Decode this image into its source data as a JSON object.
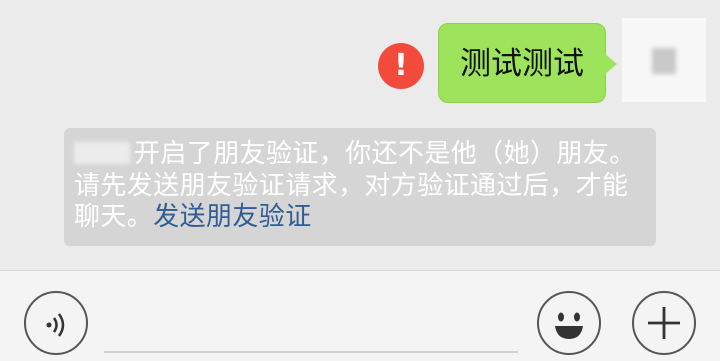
{
  "message": {
    "text": "测试测试",
    "status": "send-failed",
    "status_icon": "exclamation-icon",
    "status_glyph": "!"
  },
  "system_notice": {
    "text": "开启了朋友验证，你还不是他（她）朋友。请先发送朋友验证请求，对方验证通过后，才能聊天。",
    "link_text": "发送朋友验证"
  },
  "input_bar": {
    "left_icon": "voice-icon",
    "right_icons": [
      "emoji-icon",
      "plus-icon"
    ]
  },
  "colors": {
    "background": "#ebebeb",
    "bubble": "#9ee35c",
    "error": "#f24b3c",
    "notice_bg": "#d5d5d5",
    "link": "#2f5d94"
  }
}
